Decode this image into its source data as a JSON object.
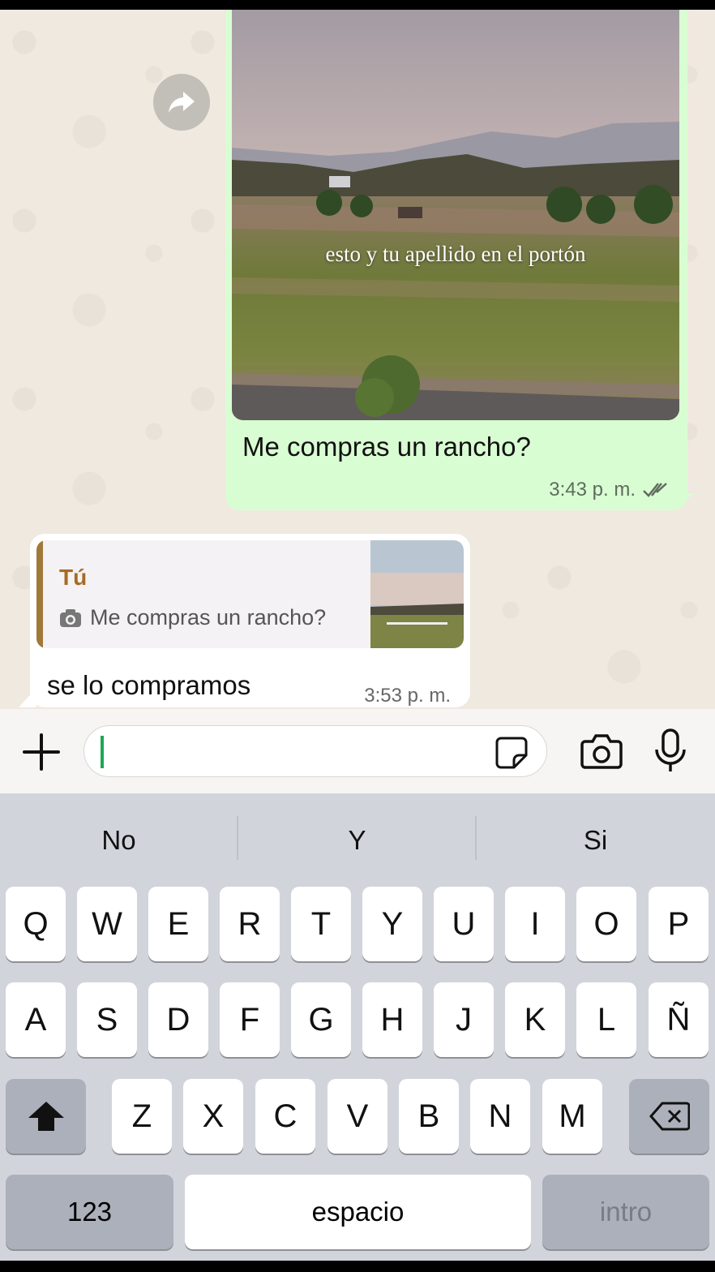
{
  "chat": {
    "outgoing": {
      "image_caption": "esto y tu apellido en el portón",
      "text": "Me compras un rancho?",
      "time": "3:43 p. m.",
      "status_icon": "double-check-icon"
    },
    "incoming": {
      "reply_author": "Tú",
      "reply_text": "Me compras un rancho?",
      "reply_icon": "camera-icon",
      "text": "se lo compramos",
      "time": "3:53 p. m."
    },
    "forward_icon": "forward-arrow-icon"
  },
  "composer": {
    "input_value": "",
    "icons": [
      "plus-icon",
      "sticker-icon",
      "camera-icon",
      "microphone-icon"
    ]
  },
  "keyboard": {
    "suggestions": [
      "No",
      "Y",
      "Si"
    ],
    "row1": [
      "Q",
      "W",
      "E",
      "R",
      "T",
      "Y",
      "U",
      "I",
      "O",
      "P"
    ],
    "row2": [
      "A",
      "S",
      "D",
      "F",
      "G",
      "H",
      "J",
      "K",
      "L",
      "Ñ"
    ],
    "row3": [
      "Z",
      "X",
      "C",
      "V",
      "B",
      "N",
      "M"
    ],
    "numbers_label": "123",
    "space_label": "espacio",
    "return_label": "intro"
  }
}
